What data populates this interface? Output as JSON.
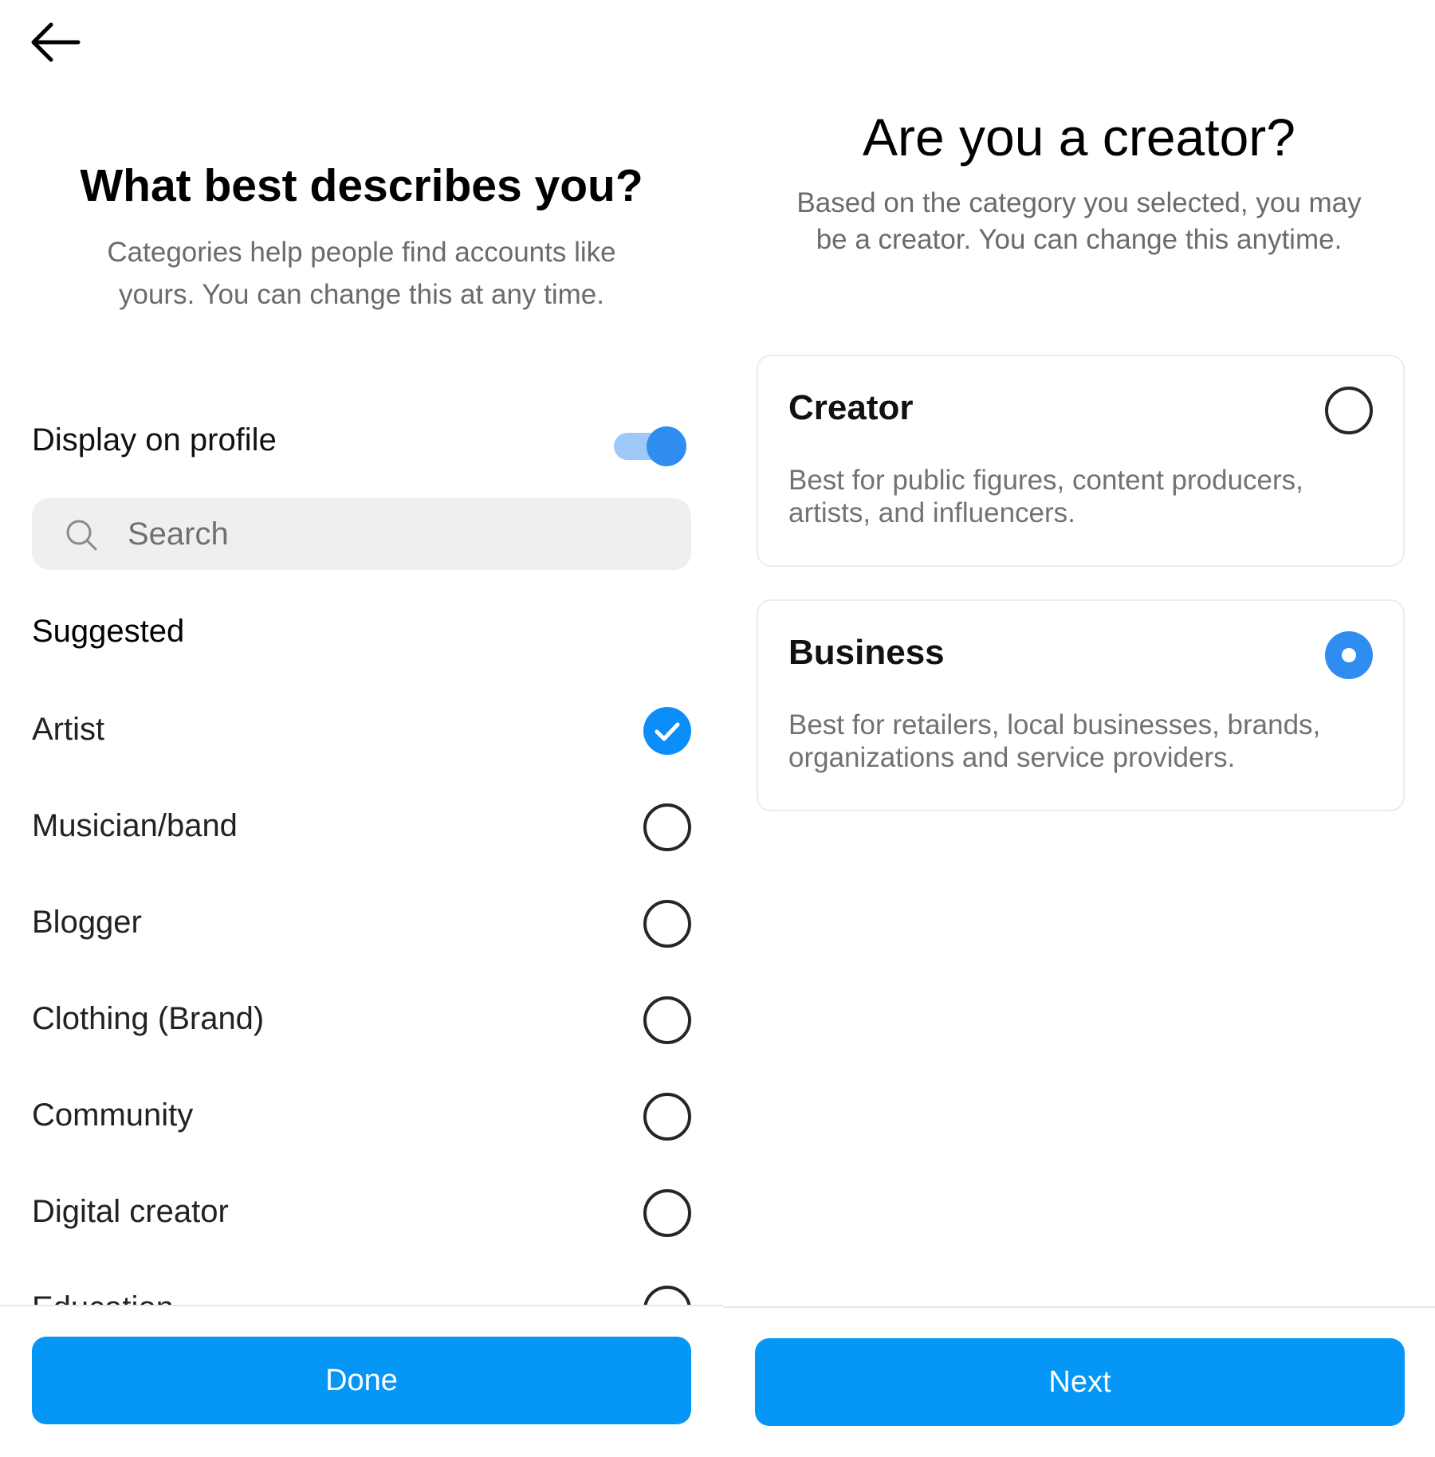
{
  "left_screen": {
    "back_icon": "arrow-left-icon",
    "title": "What best describes you?",
    "subtitle": "Categories help people find accounts like yours. You can change this at any time.",
    "display_on_profile": {
      "label": "Display on profile",
      "enabled": true
    },
    "search": {
      "placeholder": "Search",
      "value": "",
      "icon": "search-icon"
    },
    "suggested_heading": "Suggested",
    "categories": [
      {
        "label": "Artist",
        "selected": true
      },
      {
        "label": "Musician/band",
        "selected": false
      },
      {
        "label": "Blogger",
        "selected": false
      },
      {
        "label": "Clothing (Brand)",
        "selected": false
      },
      {
        "label": "Community",
        "selected": false
      },
      {
        "label": "Digital creator",
        "selected": false
      },
      {
        "label": "Education",
        "selected": false
      }
    ],
    "done_label": "Done"
  },
  "right_screen": {
    "title": "Are you a creator?",
    "subtitle": "Based on the category you selected, you may be a creator. You can change this anytime.",
    "options": [
      {
        "title": "Creator",
        "description": "Best for public figures, content producers, artists, and influencers.",
        "selected": false
      },
      {
        "title": "Business",
        "description": "Best for retailers, local businesses, brands, organizations and service providers.",
        "selected": true
      }
    ],
    "next_label": "Next"
  },
  "colors": {
    "accent": "#0596f6",
    "toggle_thumb": "#2f8df2",
    "toggle_track": "#9ec8f7",
    "check": "#0b8ef7",
    "secondary_text": "#6b6b6b"
  }
}
